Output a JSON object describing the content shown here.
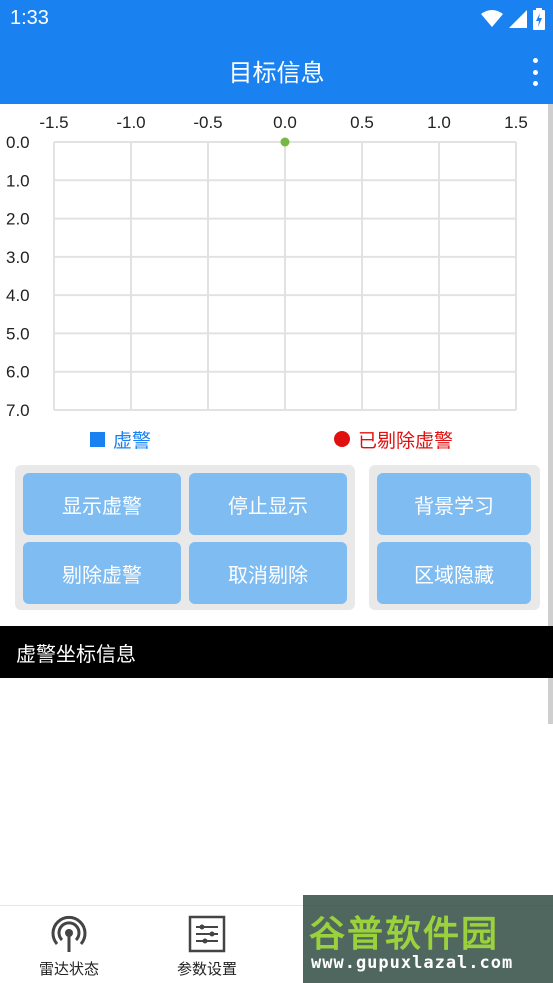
{
  "status_bar": {
    "time": "1:33"
  },
  "app_bar": {
    "title": "目标信息"
  },
  "chart_data": {
    "type": "scatter",
    "x_ticks": [
      "-1.5",
      "-1.0",
      "-0.5",
      "0.0",
      "0.5",
      "1.0",
      "1.5"
    ],
    "y_ticks": [
      "0.0",
      "1.0",
      "2.0",
      "3.0",
      "4.0",
      "5.0",
      "6.0",
      "7.0"
    ],
    "xlim": [
      -1.5,
      1.5
    ],
    "ylim": [
      0,
      7
    ],
    "y_inverted": true,
    "x_axis_position": "top",
    "grid": true,
    "points": [
      {
        "x": 0.0,
        "y": 0.0,
        "color": "#76b843"
      }
    ]
  },
  "legend": {
    "false_alarm": {
      "label": "虚警",
      "color": "#1a82f0"
    },
    "removed_false_alarm": {
      "label": "已剔除虚警",
      "color": "#e01010"
    }
  },
  "buttons": {
    "show_false_alarm": "显示虚警",
    "stop_display": "停止显示",
    "remove_false_alarm": "剔除虚警",
    "cancel_removal": "取消剔除",
    "background_learning": "背景学习",
    "area_hide": "区域隐藏"
  },
  "section": {
    "title": "虚警坐标信息"
  },
  "bottom_nav": [
    {
      "label": "雷达状态",
      "icon": "radar-icon"
    },
    {
      "label": "参数设置",
      "icon": "sliders-icon"
    }
  ],
  "watermark": {
    "main": "谷普软件园",
    "sub": "www.gupuxlazal.com"
  },
  "colors": {
    "primary": "#1a82f0",
    "button": "#7ebcf2",
    "panel": "#e9e9e9"
  }
}
